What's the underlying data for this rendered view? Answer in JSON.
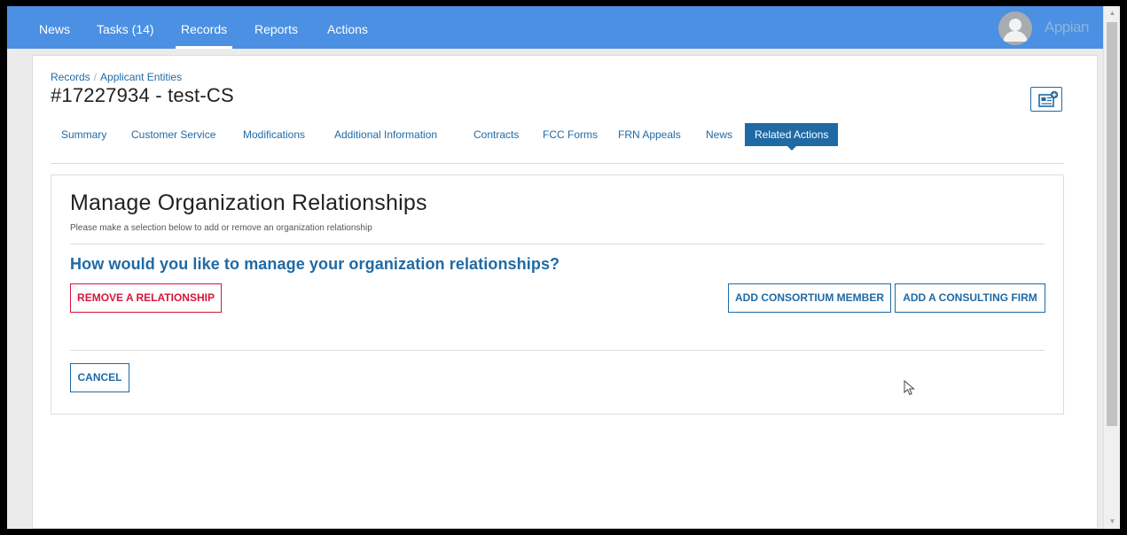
{
  "topnav": {
    "items": [
      {
        "label": "News",
        "active": false
      },
      {
        "label": "Tasks (14)",
        "active": false
      },
      {
        "label": "Records",
        "active": true
      },
      {
        "label": "Reports",
        "active": false
      },
      {
        "label": "Actions",
        "active": false
      }
    ],
    "brand": "Appian"
  },
  "breadcrumb": {
    "root": "Records",
    "current": "Applicant Entities"
  },
  "record": {
    "title": "#17227934 - test-CS"
  },
  "tabs": [
    {
      "label": "Summary"
    },
    {
      "label": "Customer Service"
    },
    {
      "label": "Modifications"
    },
    {
      "label": "Additional Information"
    },
    {
      "label": "Contracts"
    },
    {
      "label": "FCC Forms"
    },
    {
      "label": "FRN Appeals"
    },
    {
      "label": "News"
    },
    {
      "label": "Related Actions",
      "active": true
    }
  ],
  "form": {
    "title": "Manage Organization Relationships",
    "subtitle": "Please make a selection below to add or remove an organization relationship",
    "question": "How would you like to manage your organization relationships?",
    "remove_label": "REMOVE A RELATIONSHIP",
    "add_consortium_label": "ADD CONSORTIUM MEMBER",
    "add_consulting_label": "ADD A CONSULTING FIRM",
    "cancel_label": "CANCEL"
  },
  "colors": {
    "topbar": "#4b90e2",
    "accent": "#1f6aa5",
    "danger": "#d6163c"
  }
}
